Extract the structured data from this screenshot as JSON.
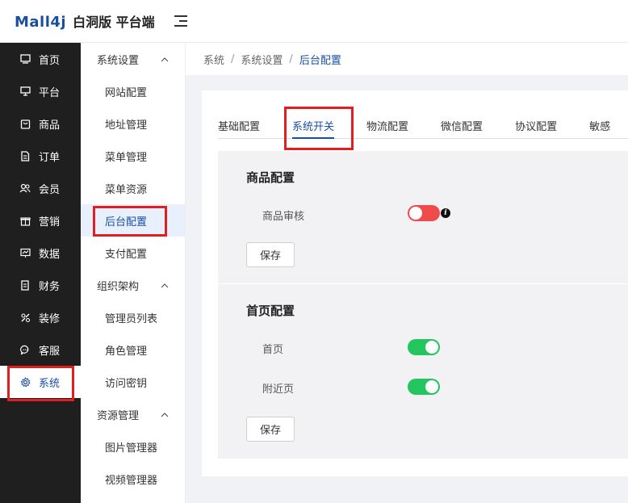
{
  "header": {
    "logo_text": "Mall4j",
    "edition": "白洞版 平台端"
  },
  "nav": {
    "items": [
      {
        "label": "首页",
        "icon": "monitor-icon"
      },
      {
        "label": "平台",
        "icon": "desktop-icon"
      },
      {
        "label": "商品",
        "icon": "bag-icon"
      },
      {
        "label": "订单",
        "icon": "document-icon"
      },
      {
        "label": "会员",
        "icon": "users-icon"
      },
      {
        "label": "营销",
        "icon": "gift-icon"
      },
      {
        "label": "数据",
        "icon": "chart-icon"
      },
      {
        "label": "财务",
        "icon": "wallet-icon"
      },
      {
        "label": "装修",
        "icon": "brush-icon"
      },
      {
        "label": "客服",
        "icon": "chat-icon"
      },
      {
        "label": "系统",
        "icon": "gear-icon"
      }
    ]
  },
  "subnav": {
    "groups": [
      {
        "label": "系统设置",
        "items": [
          "网站配置",
          "地址管理",
          "菜单管理",
          "菜单资源",
          "后台配置",
          "支付配置"
        ]
      },
      {
        "label": "组织架构",
        "items": [
          "管理员列表",
          "角色管理",
          "访问密钥"
        ]
      },
      {
        "label": "资源管理",
        "items": [
          "图片管理器",
          "视频管理器"
        ]
      }
    ]
  },
  "breadcrumb": [
    "系统",
    "系统设置",
    "后台配置"
  ],
  "tabs": [
    "基础配置",
    "系统开关",
    "物流配置",
    "微信配置",
    "协议配置",
    "敏感"
  ],
  "sections": {
    "product": {
      "title": "商品配置",
      "rows": [
        {
          "label": "商品审核",
          "enabled": false
        }
      ],
      "save_label": "保存"
    },
    "homepage": {
      "title": "首页配置",
      "rows": [
        {
          "label": "首页",
          "enabled": true
        },
        {
          "label": "附近页",
          "enabled": true
        }
      ],
      "save_label": "保存"
    }
  },
  "colors": {
    "accent": "#1a4fa0",
    "switch_on": "#22c55e",
    "switch_off": "#f04b4b",
    "highlight": "#e02020"
  }
}
